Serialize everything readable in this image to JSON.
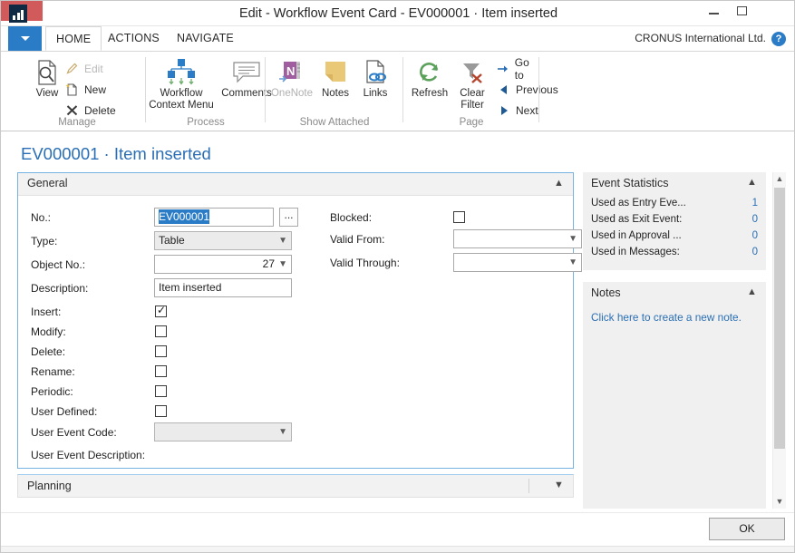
{
  "window": {
    "title": "Edit - Workflow Event Card - EV000001 · Item inserted",
    "app_icon": "chart-growth-icon",
    "minimize_label": "",
    "maximize_label": "",
    "close_label": "✕"
  },
  "ribbon": {
    "file_menu_label": "",
    "tabs": [
      {
        "label": "HOME",
        "active": true
      },
      {
        "label": "ACTIONS",
        "active": false
      },
      {
        "label": "NAVIGATE",
        "active": false
      }
    ],
    "company": "CRONUS International Ltd.",
    "help_label": "?",
    "groups": [
      {
        "label": "Manage"
      },
      {
        "label": "Process"
      },
      {
        "label": "Show Attached"
      },
      {
        "label": "Page"
      }
    ],
    "buttons": {
      "view": "View",
      "edit": "Edit",
      "new": "New",
      "delete": "Delete",
      "workflow_context_menu_line1": "Workflow",
      "workflow_context_menu_line2": "Context Menu",
      "comments": "Comments",
      "onenote": "OneNote",
      "notes": "Notes",
      "links": "Links",
      "refresh": "Refresh",
      "clear_filter_line1": "Clear",
      "clear_filter_line2": "Filter",
      "go_to": "Go to",
      "previous": "Previous",
      "next": "Next"
    }
  },
  "page": {
    "title": "EV000001 · Item inserted",
    "general": {
      "header": "General",
      "no_label": "No.:",
      "no_value": "EV000001",
      "assist_edit_label": "...",
      "type_label": "Type:",
      "type_value": "Table",
      "object_no_label": "Object No.:",
      "object_no_value": "27",
      "description_label": "Description:",
      "description_value": "Item inserted",
      "insert_label": "Insert:",
      "insert_checked": true,
      "modify_label": "Modify:",
      "modify_checked": false,
      "delete_label": "Delete:",
      "delete_checked": false,
      "rename_label": "Rename:",
      "rename_checked": false,
      "periodic_label": "Periodic:",
      "periodic_checked": false,
      "user_defined_label": "User Defined:",
      "user_defined_checked": false,
      "user_event_code_label": "User Event Code:",
      "user_event_code_value": "",
      "user_event_description_label": "User Event Description:",
      "blocked_label": "Blocked:",
      "blocked_checked": false,
      "valid_from_label": "Valid From:",
      "valid_from_value": "",
      "valid_through_label": "Valid Through:",
      "valid_through_value": ""
    },
    "planning": {
      "header": "Planning"
    }
  },
  "factboxes": {
    "event_statistics": {
      "header": "Event Statistics",
      "rows": [
        {
          "label": "Used as Entry Eve...",
          "value": "1"
        },
        {
          "label": "Used as Exit Event:",
          "value": "0"
        },
        {
          "label": "Used in Approval ...",
          "value": "0"
        },
        {
          "label": "Used in Messages:",
          "value": "0"
        }
      ]
    },
    "notes": {
      "header": "Notes",
      "link": "Click here to create a new note."
    }
  },
  "footer": {
    "ok_label": "OK"
  },
  "colors": {
    "accent_blue": "#2a7cc7",
    "link_blue": "#2a6fb5",
    "close_red": "#d15b5b",
    "card_border": "#76b3e3"
  }
}
